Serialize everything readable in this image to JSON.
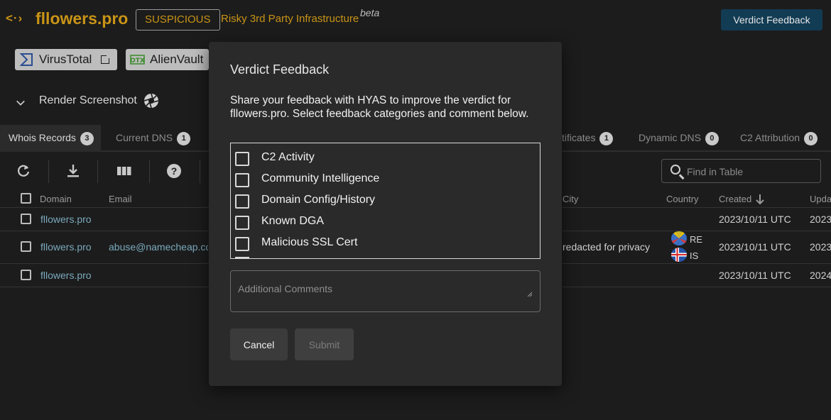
{
  "header": {
    "logo_icon": "<·›",
    "logo_text": "fllowers.pro",
    "verdict": "SUSPICIOUS",
    "verdict_desc": "Risky 3rd Party Infrastructure",
    "beta": "beta",
    "verdict_feedback_button": "Verdict Feedback",
    "accent_color": "#c99416"
  },
  "sources": [
    {
      "label": "VirusTotal",
      "icon": "sigma-icon"
    },
    {
      "label": "AlienVault",
      "icon": "otx-icon"
    }
  ],
  "render": {
    "label": "Render Screenshot"
  },
  "tabs": [
    {
      "label": "Whois Records",
      "count": "3",
      "active": true
    },
    {
      "label": "Current DNS",
      "count": "1"
    },
    {
      "label": "tificates",
      "count": "1"
    },
    {
      "label": "Dynamic DNS",
      "count": "0"
    },
    {
      "label": "C2 Attribution",
      "count": "0"
    }
  ],
  "search": {
    "placeholder": "Find in Table"
  },
  "table": {
    "headers": {
      "domain": "Domain",
      "email": "Email",
      "city": "City",
      "country": "Country",
      "created": "Created",
      "updated": "Upda"
    },
    "rows": [
      {
        "domain": "fllowers.pro",
        "email": "",
        "city": "",
        "country": [],
        "created": "2023/10/11 UTC",
        "updated": "2023"
      },
      {
        "domain": "fllowers.pro",
        "email": "abuse@namecheap.co",
        "city": "redacted for privacy",
        "country": [
          "RE",
          "IS"
        ],
        "created": "2023/10/11 UTC",
        "updated": "2023"
      },
      {
        "domain": "fllowers.pro",
        "email": "",
        "city": "",
        "country": [],
        "created": "2023/10/11 UTC",
        "updated": "2024"
      }
    ]
  },
  "modal": {
    "title": "Verdict Feedback",
    "description": "Share your feedback with HYAS to improve the verdict for fllowers.pro. Select feedback categories and comment below.",
    "categories": [
      "C2 Activity",
      "Community Intelligence",
      "Domain Config/History",
      "Known DGA",
      "Malicious SSL Cert"
    ],
    "comments_placeholder": "Additional Comments",
    "cancel": "Cancel",
    "submit": "Submit"
  }
}
